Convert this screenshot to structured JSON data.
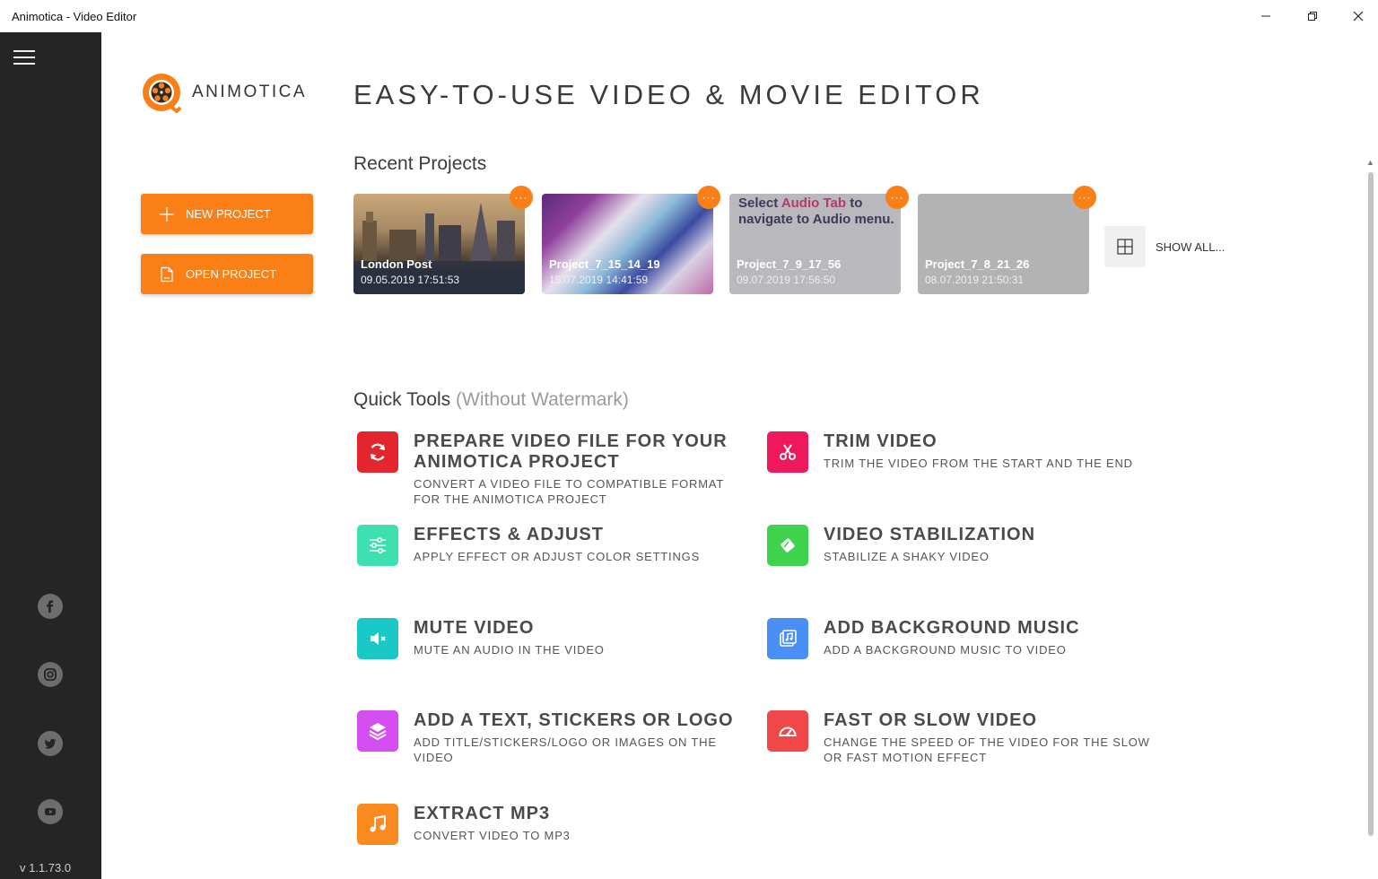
{
  "window": {
    "title": "Animotica - Video Editor"
  },
  "sidebar": {
    "version": "v 1.1.73.0",
    "social": [
      "facebook-icon",
      "instagram-icon",
      "twitter-icon",
      "youtube-icon"
    ]
  },
  "brand": {
    "name": "ANIMOTICA",
    "accent": "#fa7f16"
  },
  "actions": {
    "new_project": "NEW PROJECT",
    "open_project": "OPEN PROJECT"
  },
  "hero": {
    "title": "EASY-TO-USE VIDEO & MOVIE EDITOR"
  },
  "recent": {
    "title": "Recent Projects",
    "show_all": "SHOW ALL...",
    "projects": [
      {
        "name": "London Post",
        "date": "09.05.2019 17:51:53"
      },
      {
        "name": "Project_7_15_14_19",
        "date": "15.07.2019 14:41:59"
      },
      {
        "name": "Project_7_9_17_56",
        "date": "09.07.2019 17:56:50",
        "note_a": "Select ",
        "note_b": "Audio Tab",
        "note_c": " to navigate to Audio menu."
      },
      {
        "name": "Project_7_8_21_26",
        "date": "08.07.2019 21:50:31"
      }
    ]
  },
  "quick_tools": {
    "title": "Quick Tools",
    "subtitle": "(Without Watermark)",
    "items": [
      {
        "title": "PREPARE VIDEO FILE FOR YOUR ANIMOTICA PROJECT",
        "desc": "CONVERT A VIDEO FILE TO COMPATIBLE FORMAT FOR THE ANIMOTICA PROJECT",
        "color": "#e3262e"
      },
      {
        "title": "TRIM VIDEO",
        "desc": "TRIM THE VIDEO FROM THE START AND THE END",
        "color": "#f0185d"
      },
      {
        "title": "EFFECTS & ADJUST",
        "desc": "APPLY EFFECT OR ADJUST COLOR SETTINGS",
        "color": "#3fe0b0"
      },
      {
        "title": "VIDEO STABILIZATION",
        "desc": "STABILIZE A SHAKY VIDEO",
        "color": "#3fd24c"
      },
      {
        "title": "MUTE VIDEO",
        "desc": "MUTE AN AUDIO IN THE VIDEO",
        "color": "#1bc8c8"
      },
      {
        "title": "ADD BACKGROUND MUSIC",
        "desc": "ADD A BACKGROUND MUSIC TO VIDEO",
        "color": "#4a8ff5"
      },
      {
        "title": "ADD A TEXT, STICKERS OR LOGO",
        "desc": "ADD TITLE/STICKERS/LOGO OR IMAGES ON THE VIDEO",
        "color": "#d34df0"
      },
      {
        "title": "FAST OR SLOW VIDEO",
        "desc": "CHANGE THE SPEED OF THE VIDEO FOR THE SLOW OR FAST MOTION EFFECT",
        "color": "#f04848"
      },
      {
        "title": "EXTRACT MP3",
        "desc": "CONVERT VIDEO TO MP3",
        "color": "#fa8a1e"
      }
    ]
  }
}
